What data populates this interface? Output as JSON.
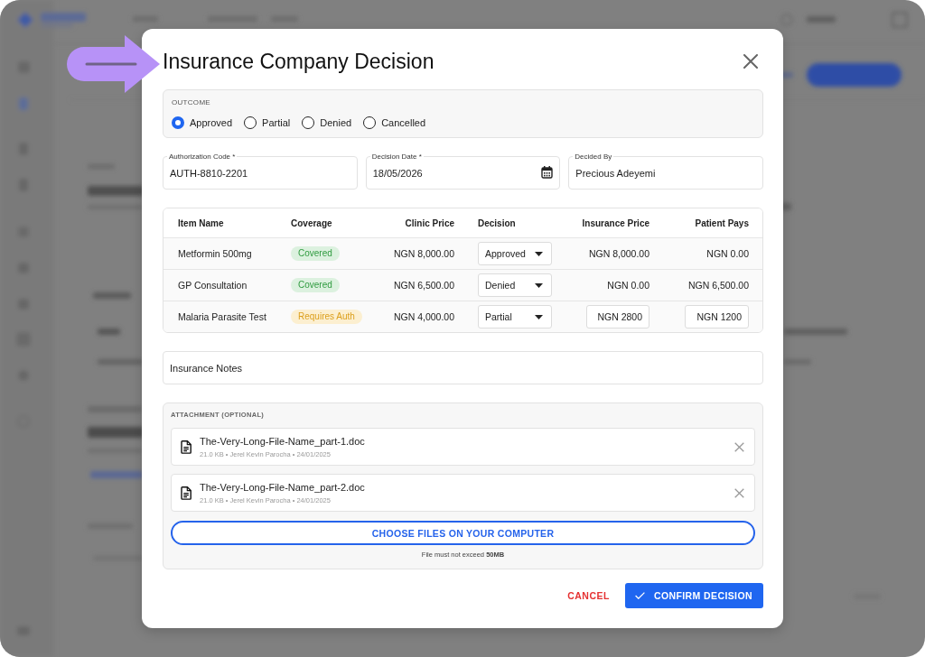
{
  "dialog": {
    "title": "Insurance Company Decision"
  },
  "outcome": {
    "label": "OUTCOME",
    "options": [
      {
        "label": "Approved",
        "selected": true
      },
      {
        "label": "Partial",
        "selected": false
      },
      {
        "label": "Denied",
        "selected": false
      },
      {
        "label": "Cancelled",
        "selected": false
      }
    ]
  },
  "fields": [
    {
      "kind": "text",
      "label": "Authorization Code *",
      "value": "AUTH-8810-2201"
    },
    {
      "kind": "date",
      "label": "Decision Date *",
      "value": "18/05/2026"
    },
    {
      "kind": "text",
      "label": "Decided By",
      "value": "Precious Adeyemi"
    }
  ],
  "items_table": {
    "columns": [
      "Item Name",
      "Coverage",
      "Clinic Price",
      "Decision",
      "Insurance Price",
      "Patient Pays"
    ],
    "rows": [
      {
        "item": "Metformin 500mg",
        "coverage": {
          "kind": "covered",
          "label": "Covered"
        },
        "clinic_price": "NGN 8,000.00",
        "decision": "Approved",
        "insurance_price": {
          "kind": "text",
          "value": "NGN 8,000.00"
        },
        "patient_pays": {
          "kind": "text",
          "value": "NGN 0.00"
        }
      },
      {
        "item": "GP Consultation",
        "coverage": {
          "kind": "covered",
          "label": "Covered"
        },
        "clinic_price": "NGN 6,500.00",
        "decision": "Denied",
        "insurance_price": {
          "kind": "text",
          "value": "NGN 0.00"
        },
        "patient_pays": {
          "kind": "text",
          "value": "NGN 6,500.00"
        }
      },
      {
        "item": "Malaria Parasite Test",
        "coverage": {
          "kind": "requires_auth",
          "label": "Requires Auth"
        },
        "clinic_price": "NGN 4,000.00",
        "decision": "Partial",
        "insurance_price": {
          "kind": "input",
          "value": "NGN 2800"
        },
        "patient_pays": {
          "kind": "input",
          "value": "NGN 1200"
        }
      }
    ]
  },
  "notes": {
    "placeholder": "Insurance Notes"
  },
  "attachments": {
    "label": "ATTACHMENT (OPTIONAL)",
    "files": [
      {
        "name": "The-Very-Long-File-Name_part-1.doc",
        "meta": "21.0 KB • Jerel Kevin Parocha • 24/01/2025"
      },
      {
        "name": "The-Very-Long-File-Name_part-2.doc",
        "meta": "21.0 KB • Jerel Kevin Parocha • 24/01/2025"
      }
    ],
    "choose_button": "CHOOSE FILES ON YOUR COMPUTER",
    "hint": "File must not exceed **50MB**"
  },
  "actions": {
    "cancel": "CANCEL",
    "confirm": "CONFIRM DECISION"
  }
}
